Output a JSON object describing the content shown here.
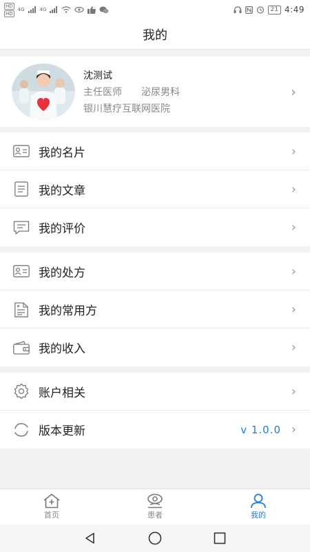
{
  "status_bar": {
    "chip_top": "HD",
    "chip_bottom": "HD",
    "network_1": "4G",
    "network_2": "4G",
    "battery": "21",
    "time": "4:49"
  },
  "header": {
    "title": "我的"
  },
  "profile": {
    "name": "沈测试",
    "title": "主任医师",
    "department": "泌尿男科",
    "hospital": "银川慧疗互联网医院"
  },
  "menu_groups": [
    {
      "items": [
        {
          "label": "我的名片",
          "icon": "id-card-icon"
        },
        {
          "label": "我的文章",
          "icon": "article-icon"
        },
        {
          "label": "我的评价",
          "icon": "comment-icon"
        }
      ]
    },
    {
      "items": [
        {
          "label": "我的处方",
          "icon": "prescription-icon"
        },
        {
          "label": "我的常用方",
          "icon": "common-prescription-icon"
        },
        {
          "label": "我的收入",
          "icon": "wallet-icon"
        }
      ]
    },
    {
      "items": [
        {
          "label": "账户相关",
          "icon": "gear-icon"
        },
        {
          "label": "版本更新",
          "icon": "refresh-icon",
          "value": "v 1.0.0"
        }
      ]
    }
  ],
  "tabs": [
    {
      "label": "首页",
      "icon": "home-icon",
      "active": false
    },
    {
      "label": "患者",
      "icon": "patient-icon",
      "active": false
    },
    {
      "label": "我的",
      "icon": "user-icon",
      "active": true
    }
  ],
  "colors": {
    "accent": "#1f7fd6",
    "text": "#222222",
    "muted": "#888888",
    "background": "#f2f2f2"
  }
}
